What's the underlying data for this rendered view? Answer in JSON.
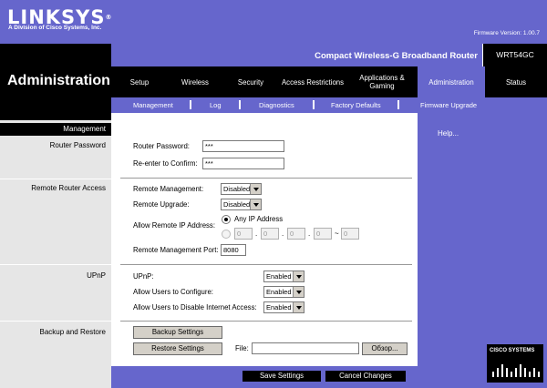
{
  "brand": {
    "logo": "LINKSYS",
    "tm": "®",
    "sub": "A Division of Cisco Systems, Inc.",
    "firmware": "Firmware Version: 1.00.7"
  },
  "header": {
    "page_title": "Administration",
    "product_name": "Compact Wireless-G Broadband Router",
    "model": "WRT54GC"
  },
  "tabs": [
    {
      "label": "Setup"
    },
    {
      "label": "Wireless"
    },
    {
      "label": "Security"
    },
    {
      "label": "Access Restrictions"
    },
    {
      "label": "Applications & Gaming"
    },
    {
      "label": "Administration"
    },
    {
      "label": "Status"
    }
  ],
  "subtabs": [
    {
      "label": "Management"
    },
    {
      "label": "Log"
    },
    {
      "label": "Diagnostics"
    },
    {
      "label": "Factory Defaults"
    },
    {
      "label": "Firmware Upgrade"
    }
  ],
  "left": {
    "management": "Management",
    "router_password": "Router Password",
    "remote_access": "Remote Router Access",
    "upnp": "UPnP",
    "backup": "Backup and Restore"
  },
  "help": "Help...",
  "router_password": {
    "label": "Router Password:",
    "value": "***",
    "confirm_label": "Re-enter to Confirm:",
    "confirm_value": "***"
  },
  "remote": {
    "mgmt_label": "Remote Management:",
    "mgmt_value": "Disabled",
    "upgrade_label": "Remote Upgrade:",
    "upgrade_value": "Disabled",
    "allow_ip_label": "Allow Remote IP Address:",
    "any_ip": "Any IP Address",
    "ip_parts": [
      "0",
      "0",
      "0",
      "0"
    ],
    "ip_end": "0",
    "ip_sep": ".",
    "ip_range_sep": "~",
    "port_label": "Remote Management Port:",
    "port_value": "8080"
  },
  "upnp": {
    "upnp_label": "UPnP:",
    "upnp_value": "Enabled",
    "configure_label": "Allow Users to Configure:",
    "configure_value": "Enabled",
    "disable_label": "Allow Users to Disable Internet Access:",
    "disable_value": "Enabled"
  },
  "backup": {
    "backup_button": "Backup Settings",
    "restore_button": "Restore Settings",
    "file_label": "File:",
    "file_value": "",
    "browse_button": "Обзор..."
  },
  "footer": {
    "save": "Save Settings",
    "cancel": "Cancel Changes"
  },
  "cisco": {
    "text": "CISCO SYSTEMS"
  },
  "colors": {
    "brand_purple": "#6666cc",
    "black": "#000000",
    "panel_grey": "#e6e6e6"
  }
}
